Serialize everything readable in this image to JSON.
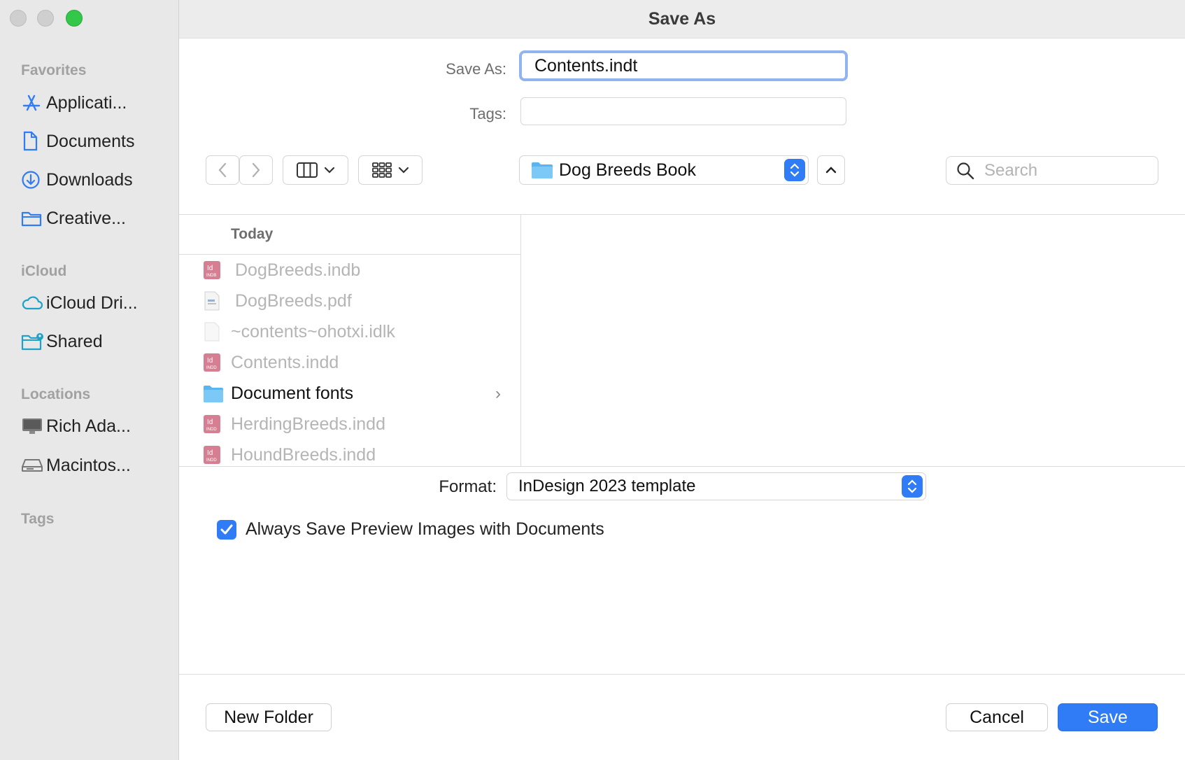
{
  "window": {
    "title": "Save As"
  },
  "sidebar": {
    "favorites_heading": "Favorites",
    "favorites": [
      {
        "label": "Applicati...",
        "icon": "applications-icon"
      },
      {
        "label": "Documents",
        "icon": "document-icon"
      },
      {
        "label": "Downloads",
        "icon": "downloads-icon"
      },
      {
        "label": "Creative...",
        "icon": "folder-icon"
      }
    ],
    "icloud_heading": "iCloud",
    "icloud": [
      {
        "label": "iCloud Dri...",
        "icon": "cloud-icon"
      },
      {
        "label": "Shared",
        "icon": "shared-folder-icon"
      }
    ],
    "locations_heading": "Locations",
    "locations": [
      {
        "label": "Rich Ada...",
        "icon": "computer-icon"
      },
      {
        "label": "Macintos...",
        "icon": "disk-icon"
      }
    ],
    "tags_heading": "Tags"
  },
  "form": {
    "save_as_label": "Save As:",
    "save_as_value": "Contents.indt",
    "tags_label": "Tags:",
    "tags_value": ""
  },
  "toolbar": {
    "location": "Dog Breeds Book",
    "search_placeholder": "Search"
  },
  "browser": {
    "column_header": "Today",
    "files": [
      {
        "name": "DogBreeds.indb",
        "type": "indb",
        "dimmed": true
      },
      {
        "name": "DogBreeds.pdf",
        "type": "pdf",
        "dimmed": true
      },
      {
        "name": "~contents~ohotxi.idlk",
        "type": "blank",
        "dimmed": true
      },
      {
        "name": "Contents.indd",
        "type": "indd",
        "dimmed": true
      },
      {
        "name": "Document fonts",
        "type": "folder",
        "dimmed": false
      },
      {
        "name": "HerdingBreeds.indd",
        "type": "indd",
        "dimmed": true
      },
      {
        "name": "HoundBreeds.indd",
        "type": "indd",
        "dimmed": true
      }
    ]
  },
  "options": {
    "format_label": "Format:",
    "format_value": "InDesign 2023 template",
    "preview_checkbox_label": "Always Save Preview Images with Documents",
    "preview_checked": true
  },
  "buttons": {
    "new_folder": "New Folder",
    "cancel": "Cancel",
    "save": "Save"
  },
  "colors": {
    "accent": "#2f7cf6",
    "close_green": "#34c84a",
    "indesign": "#c8546e"
  }
}
